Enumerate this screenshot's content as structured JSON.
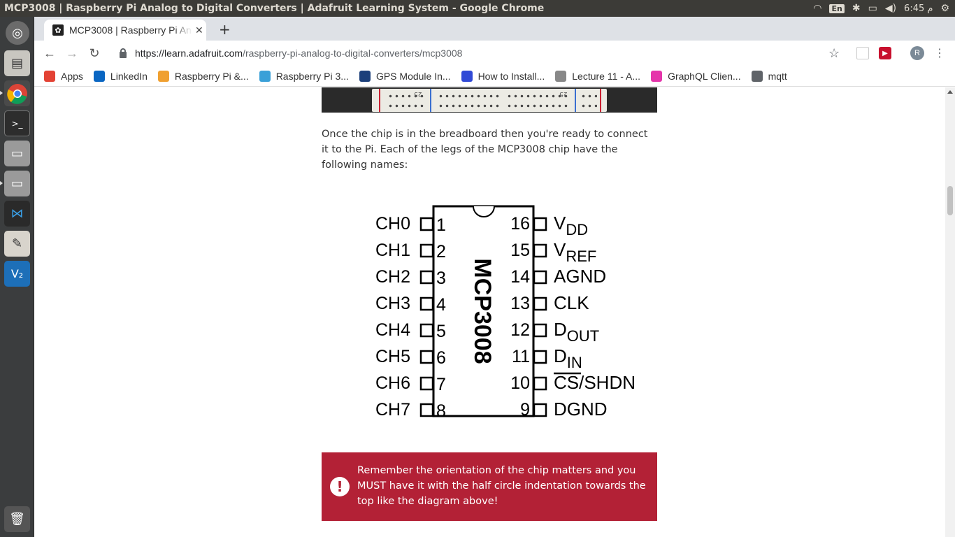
{
  "window": {
    "title": "MCP3008 | Raspberry Pi Analog to Digital Converters | Adafruit Learning System - Google Chrome"
  },
  "panel": {
    "lang": "En",
    "clock": "6:45 م"
  },
  "tab": {
    "title": "MCP3008 | Raspberry Pi Analog to Digital Converters | Adafruit Learning System",
    "close": "✕",
    "new_tab": "+"
  },
  "toolbar": {
    "url_host": "https://learn.adafruit.com",
    "url_path": "/raspberry-pi-analog-to-digital-converters/mcp3008",
    "profile_initial": "R"
  },
  "bookmarks": [
    {
      "label": "Apps",
      "icon": "apps-grid-icon",
      "color": "#e34234"
    },
    {
      "label": "LinkedIn",
      "icon": "linkedin-icon",
      "color": "#0a66c2"
    },
    {
      "label": "Raspberry Pi &...",
      "icon": "raspberry-icon",
      "color": "#f0a030"
    },
    {
      "label": "Raspberry Pi 3...",
      "icon": "globe-icon",
      "color": "#3aa0d8"
    },
    {
      "label": "GPS Module In...",
      "icon": "ew-icon",
      "color": "#1b3f7a"
    },
    {
      "label": "How to Install...",
      "icon": "vuetify-icon",
      "color": "#3049d6"
    },
    {
      "label": "Lecture 11 - A...",
      "icon": "document-icon",
      "color": "#888888"
    },
    {
      "label": "GraphQL Clien...",
      "icon": "graphql-icon",
      "color": "#e535ab"
    },
    {
      "label": "mqtt",
      "icon": "folder-icon",
      "color": "#5f6368"
    }
  ],
  "breadboard": {
    "label_left": "25",
    "label_right": "25"
  },
  "content": {
    "paragraph": "Once the chip is in the breadboard then you're ready to connect it to the Pi.  Each of the legs of the MCP3008 chip have the following names:"
  },
  "diagram": {
    "chip_name": "MCP3008",
    "left_pins": [
      {
        "name": "CH0",
        "num": "1"
      },
      {
        "name": "CH1",
        "num": "2"
      },
      {
        "name": "CH2",
        "num": "3"
      },
      {
        "name": "CH3",
        "num": "4"
      },
      {
        "name": "CH4",
        "num": "5"
      },
      {
        "name": "CH5",
        "num": "6"
      },
      {
        "name": "CH6",
        "num": "7"
      },
      {
        "name": "CH7",
        "num": "8"
      }
    ],
    "right_pins": [
      {
        "num": "16",
        "main": "V",
        "sub": "DD"
      },
      {
        "num": "15",
        "main": "V",
        "sub": "REF"
      },
      {
        "num": "14",
        "main": "AGND",
        "sub": ""
      },
      {
        "num": "13",
        "main": "CLK",
        "sub": ""
      },
      {
        "num": "12",
        "main": "D",
        "sub": "OUT"
      },
      {
        "num": "11",
        "main": "D",
        "sub": "IN"
      },
      {
        "num": "10",
        "main": "CS/SHDN",
        "sub": ""
      },
      {
        "num": "9",
        "main": "DGND",
        "sub": ""
      }
    ]
  },
  "warning": {
    "icon": "!",
    "text": "Remember the orientation of the chip matters and you MUST have it with the half circle indentation towards the top like the diagram above!"
  }
}
